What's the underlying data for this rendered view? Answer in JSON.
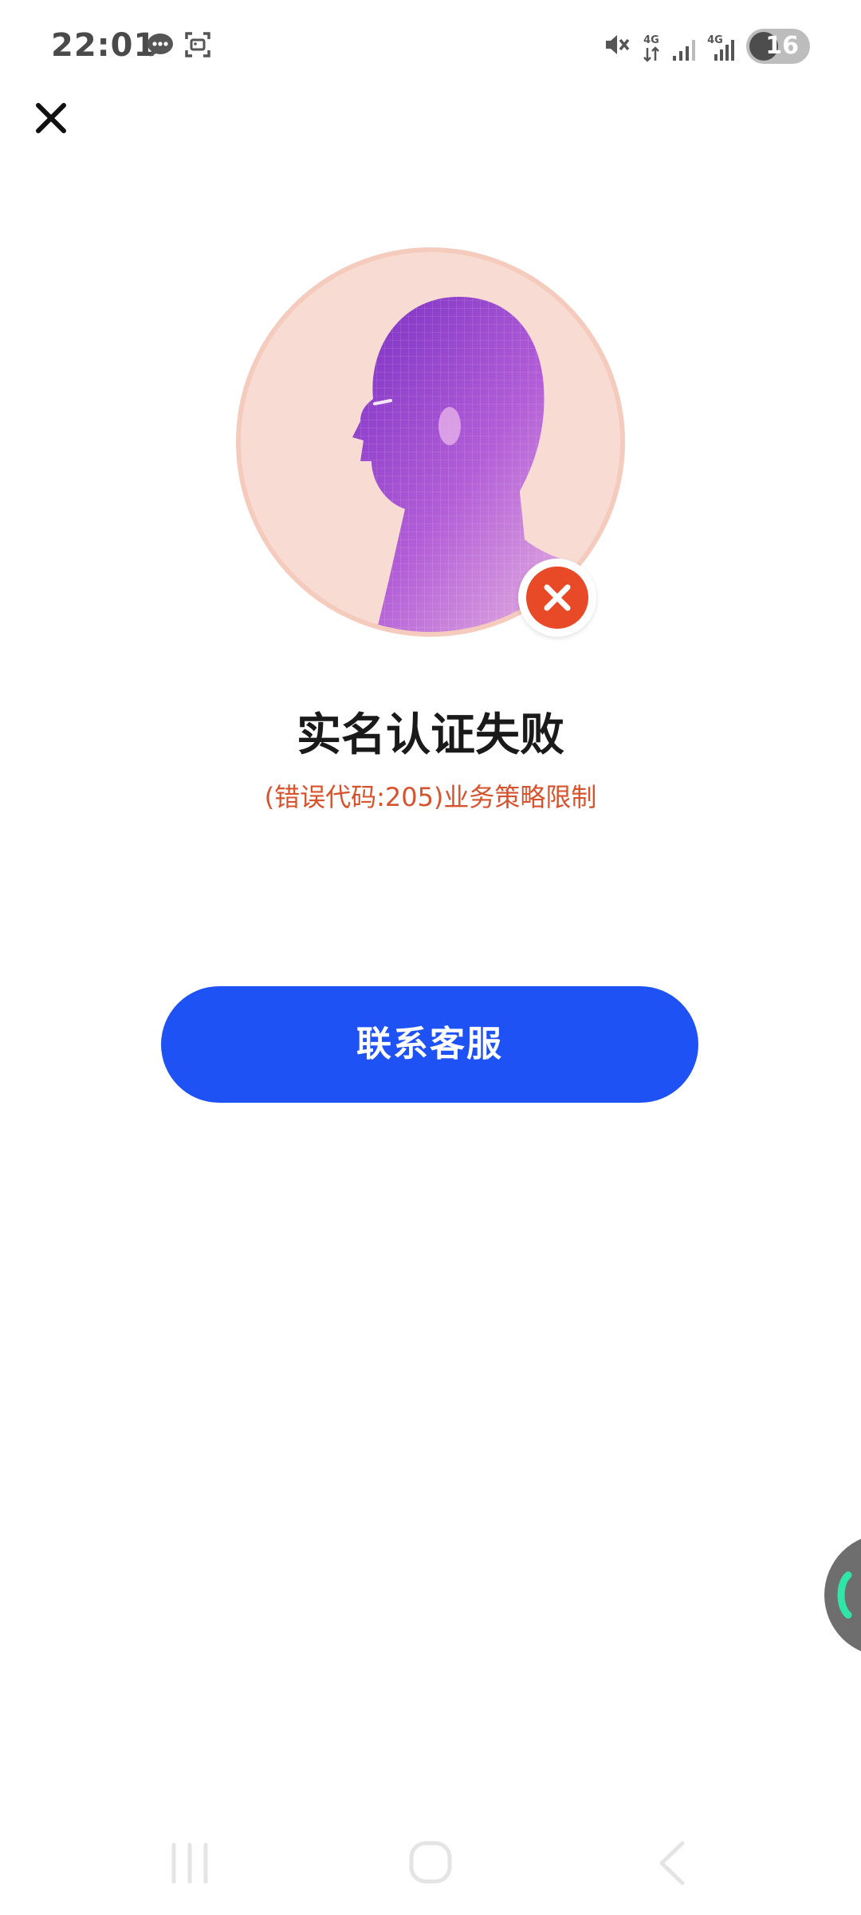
{
  "status_bar": {
    "time": "22:01",
    "battery": "16",
    "icons": [
      "message-icon",
      "screenshot-icon",
      "mute-icon",
      "4g-icon",
      "signal-icon",
      "4g-icon",
      "signal-icon",
      "battery-icon"
    ]
  },
  "header": {
    "close_icon": "close-icon"
  },
  "result": {
    "title": "实名认证失败",
    "error": "(错误代码:205)业务策略限制",
    "status_icon": "fail-icon"
  },
  "actions": {
    "contact_label": "联系客服"
  },
  "nav_bar": {
    "icons": [
      "recent-apps-icon",
      "home-icon",
      "back-icon"
    ]
  },
  "colors": {
    "primary": "#1e52f5",
    "error": "#d6532d",
    "fail_badge": "#e84a27",
    "avatar_bg": "#f8dcd4"
  }
}
